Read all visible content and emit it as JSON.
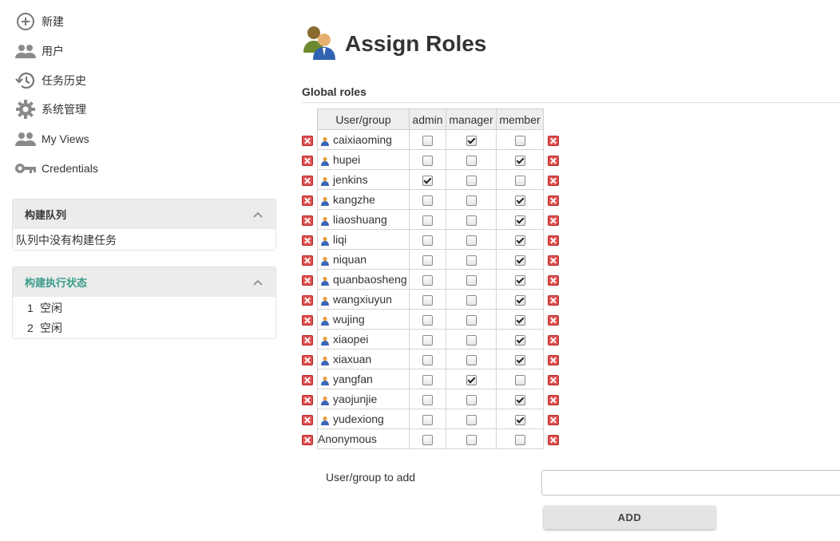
{
  "sidebar": {
    "tasks": [
      {
        "label": "新建",
        "icon": "plus-circle-icon"
      },
      {
        "label": "用户",
        "icon": "people-icon"
      },
      {
        "label": "任务历史",
        "icon": "history-icon"
      },
      {
        "label": "系统管理",
        "icon": "gear-icon"
      },
      {
        "label": "My Views",
        "icon": "people-icon"
      },
      {
        "label": "Credentials",
        "icon": "key-icon"
      }
    ],
    "build_queue": {
      "title": "构建队列",
      "empty_text": "队列中没有构建任务"
    },
    "executor_status": {
      "title": "构建执行状态",
      "executors": [
        {
          "number": "1",
          "status": "空闲"
        },
        {
          "number": "2",
          "status": "空闲"
        }
      ]
    }
  },
  "page": {
    "title": "Assign Roles",
    "section_title": "Global roles"
  },
  "roles_table": {
    "headers": {
      "user": "User/group",
      "admin": "admin",
      "manager": "manager",
      "member": "member"
    },
    "rows": [
      {
        "name": "caixiaoming",
        "admin": false,
        "manager": true,
        "member": false,
        "is_user": true
      },
      {
        "name": "hupei",
        "admin": false,
        "manager": false,
        "member": true,
        "is_user": true
      },
      {
        "name": "jenkins",
        "admin": true,
        "manager": false,
        "member": false,
        "is_user": true
      },
      {
        "name": "kangzhe",
        "admin": false,
        "manager": false,
        "member": true,
        "is_user": true
      },
      {
        "name": "liaoshuang",
        "admin": false,
        "manager": false,
        "member": true,
        "is_user": true
      },
      {
        "name": "liqi",
        "admin": false,
        "manager": false,
        "member": true,
        "is_user": true
      },
      {
        "name": "niquan",
        "admin": false,
        "manager": false,
        "member": true,
        "is_user": true
      },
      {
        "name": "quanbaosheng",
        "admin": false,
        "manager": false,
        "member": true,
        "is_user": true
      },
      {
        "name": "wangxiuyun",
        "admin": false,
        "manager": false,
        "member": true,
        "is_user": true
      },
      {
        "name": "wujing",
        "admin": false,
        "manager": false,
        "member": true,
        "is_user": true
      },
      {
        "name": "xiaopei",
        "admin": false,
        "manager": false,
        "member": true,
        "is_user": true
      },
      {
        "name": "xiaxuan",
        "admin": false,
        "manager": false,
        "member": true,
        "is_user": true
      },
      {
        "name": "yangfan",
        "admin": false,
        "manager": true,
        "member": false,
        "is_user": true
      },
      {
        "name": "yaojunjie",
        "admin": false,
        "manager": false,
        "member": true,
        "is_user": true
      },
      {
        "name": "yudexiong",
        "admin": false,
        "manager": false,
        "member": true,
        "is_user": true
      },
      {
        "name": "Anonymous",
        "admin": false,
        "manager": false,
        "member": false,
        "is_user": false
      }
    ]
  },
  "add_form": {
    "label": "User/group to add",
    "value": "",
    "button_label": "ADD"
  },
  "colors": {
    "accent_teal": "#3a9c8a",
    "delete_red": "#e05050",
    "pane_header": "#ececec",
    "button_bg": "#e4e4e4"
  }
}
